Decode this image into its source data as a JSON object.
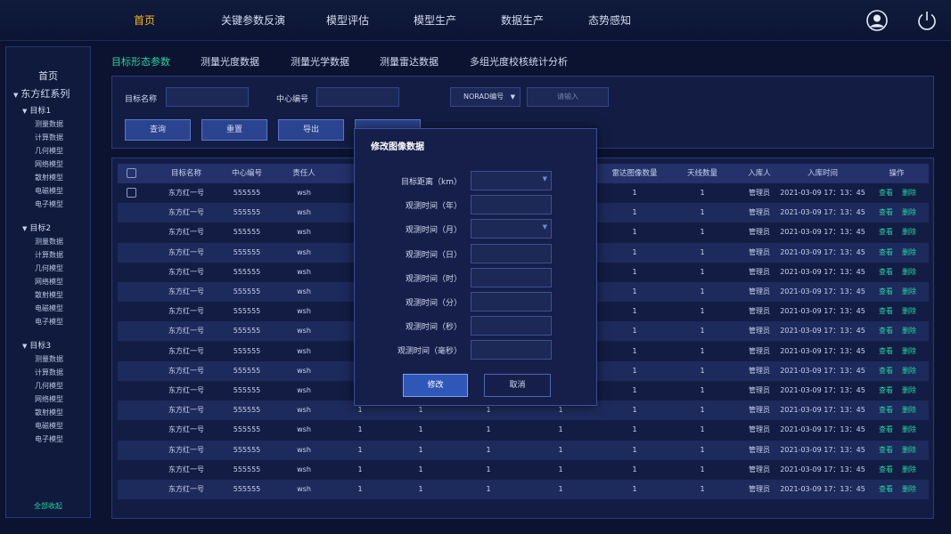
{
  "topnav": [
    {
      "label": "首页",
      "active": true
    },
    {
      "label": "关键参数反演",
      "active": false
    },
    {
      "label": "模型评估",
      "active": false
    },
    {
      "label": "模型生产",
      "active": false
    },
    {
      "label": "数据生产",
      "active": false
    },
    {
      "label": "态势感知",
      "active": false
    }
  ],
  "sidebar": {
    "home": "首页",
    "root": "东方红系列",
    "groups": [
      {
        "label": "目标1",
        "items": [
          "测量数据",
          "计算数据",
          "几何模型",
          "网络模型",
          "散射模型",
          "电磁模型",
          "电子模型"
        ]
      },
      {
        "label": "目标2",
        "items": [
          "测量数据",
          "计算数据",
          "几何模型",
          "网络模型",
          "散射模型",
          "电磁模型",
          "电子模型"
        ]
      },
      {
        "label": "目标3",
        "items": [
          "测量数据",
          "计算数据",
          "几何模型",
          "网络模型",
          "散射模型",
          "电磁模型",
          "电子模型"
        ]
      }
    ],
    "collapse_all": "全部收起"
  },
  "subtabs": [
    {
      "label": "目标形态参数",
      "active": true
    },
    {
      "label": "测量光度数据",
      "active": false
    },
    {
      "label": "测量光学数据",
      "active": false
    },
    {
      "label": "测量雷达数据",
      "active": false
    },
    {
      "label": "多组光度校核统计分析",
      "active": false
    }
  ],
  "filter": {
    "target_name_label": "目标名称",
    "center_no_label": "中心编号",
    "norad_select": "NORAD编号",
    "norad_placeholder": "请输入",
    "query": "查询",
    "reset": "重置",
    "export": "导出"
  },
  "table": {
    "headers": [
      "目标名称",
      "中心编号",
      "责任人",
      "雷达图像数量",
      "天线数量",
      "入库人",
      "入库时间",
      "操作"
    ],
    "row": {
      "name": "东方红一号",
      "center": "555555",
      "owner": "wsh",
      "c1": "1",
      "c2": "1",
      "c3": "1",
      "c4": "1",
      "radar_count": "1",
      "antenna_count": "1",
      "storer": "管理员",
      "time": "2021-03-09 17：13：45",
      "view": "查看",
      "delete": "删除"
    },
    "row_count": 16
  },
  "modal": {
    "title": "修改图像数据",
    "fields": [
      {
        "label": "目标距离（km）",
        "type": "select"
      },
      {
        "label": "观测时间（年）",
        "type": "input"
      },
      {
        "label": "观测时间（月）",
        "type": "select"
      },
      {
        "label": "观测时间（日）",
        "type": "input"
      },
      {
        "label": "观测时间（时）",
        "type": "input"
      },
      {
        "label": "观测时间（分）",
        "type": "input"
      },
      {
        "label": "观测时间（秒）",
        "type": "input"
      },
      {
        "label": "观测时间（毫秒）",
        "type": "input"
      }
    ],
    "ok": "修改",
    "cancel": "取消"
  }
}
